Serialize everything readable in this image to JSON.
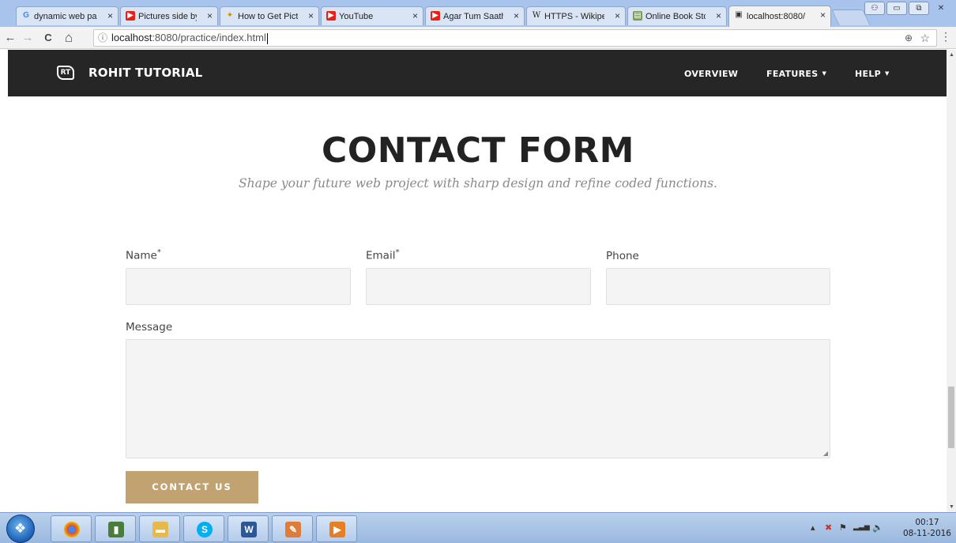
{
  "browser": {
    "tabs": [
      {
        "icon": "google-icon",
        "label": "dynamic web pa",
        "active": false
      },
      {
        "icon": "youtube-icon",
        "label": "Pictures side by",
        "active": false
      },
      {
        "icon": "web-icon",
        "label": "How to Get Pictu",
        "active": false
      },
      {
        "icon": "youtube-icon",
        "label": "YouTube",
        "active": false
      },
      {
        "icon": "youtube-icon",
        "label": "Agar Tum Saath",
        "active": false
      },
      {
        "icon": "wikipedia-icon",
        "label": "HTTPS - Wikipe",
        "active": false
      },
      {
        "icon": "book-icon",
        "label": "Online Book Sto",
        "active": false
      },
      {
        "icon": "page-icon",
        "label": "localhost:8080/",
        "active": true
      }
    ],
    "close_glyph": "×",
    "url_host": "localhost",
    "url_path": ":8080/practice/index.html",
    "info_glyph": "ⓘ",
    "zoom_glyph": "⊕",
    "star_glyph": "☆",
    "menu_glyph": "⋮",
    "back_glyph": "←",
    "forward_glyph": "→",
    "reload_glyph": "C",
    "home_glyph": "⌂",
    "window_controls": [
      "⚇",
      "▭",
      "⧉",
      "✕"
    ]
  },
  "site": {
    "logo_text": "RT",
    "brand": "ROHIT TUTORIAL",
    "nav": [
      {
        "label": "OVERVIEW",
        "dropdown": false
      },
      {
        "label": "FEATURES",
        "dropdown": true
      },
      {
        "label": "HELP",
        "dropdown": true
      }
    ],
    "dropdown_glyph": "▼"
  },
  "contact": {
    "title": "CONTACT FORM",
    "subtitle": "Shape your future web project with sharp design and refine coded functions.",
    "fields": {
      "name_label": "Name",
      "email_label": "Email",
      "phone_label": "Phone",
      "message_label": "Message",
      "required_mark": "*"
    },
    "submit_label": "CONTACT US"
  },
  "taskbar": {
    "start_glyph": "❖",
    "apps": [
      {
        "icon": "chrome-icon",
        "color": "#db4437",
        "glyph": "●"
      },
      {
        "icon": "charts-icon",
        "color": "#4a7d3a",
        "glyph": "▮"
      },
      {
        "icon": "folder-icon",
        "color": "#e8b84a",
        "glyph": "▬"
      },
      {
        "icon": "skype-icon",
        "color": "#00aff0",
        "glyph": "S"
      },
      {
        "icon": "word-icon",
        "color": "#2b5797",
        "glyph": "W"
      },
      {
        "icon": "paint-icon",
        "color": "#e07b39",
        "glyph": "✎"
      },
      {
        "icon": "media-icon",
        "color": "#e67e22",
        "glyph": "▶"
      }
    ],
    "tray_glyphs": [
      "▴",
      "✖",
      "⚑",
      "▂▃▅",
      "🔈"
    ],
    "time": "00:17",
    "date": "08-11-2016"
  },
  "colors": {
    "nav_bg": "#262626",
    "accent": "#c1a371",
    "input_bg": "#f4f4f4"
  }
}
